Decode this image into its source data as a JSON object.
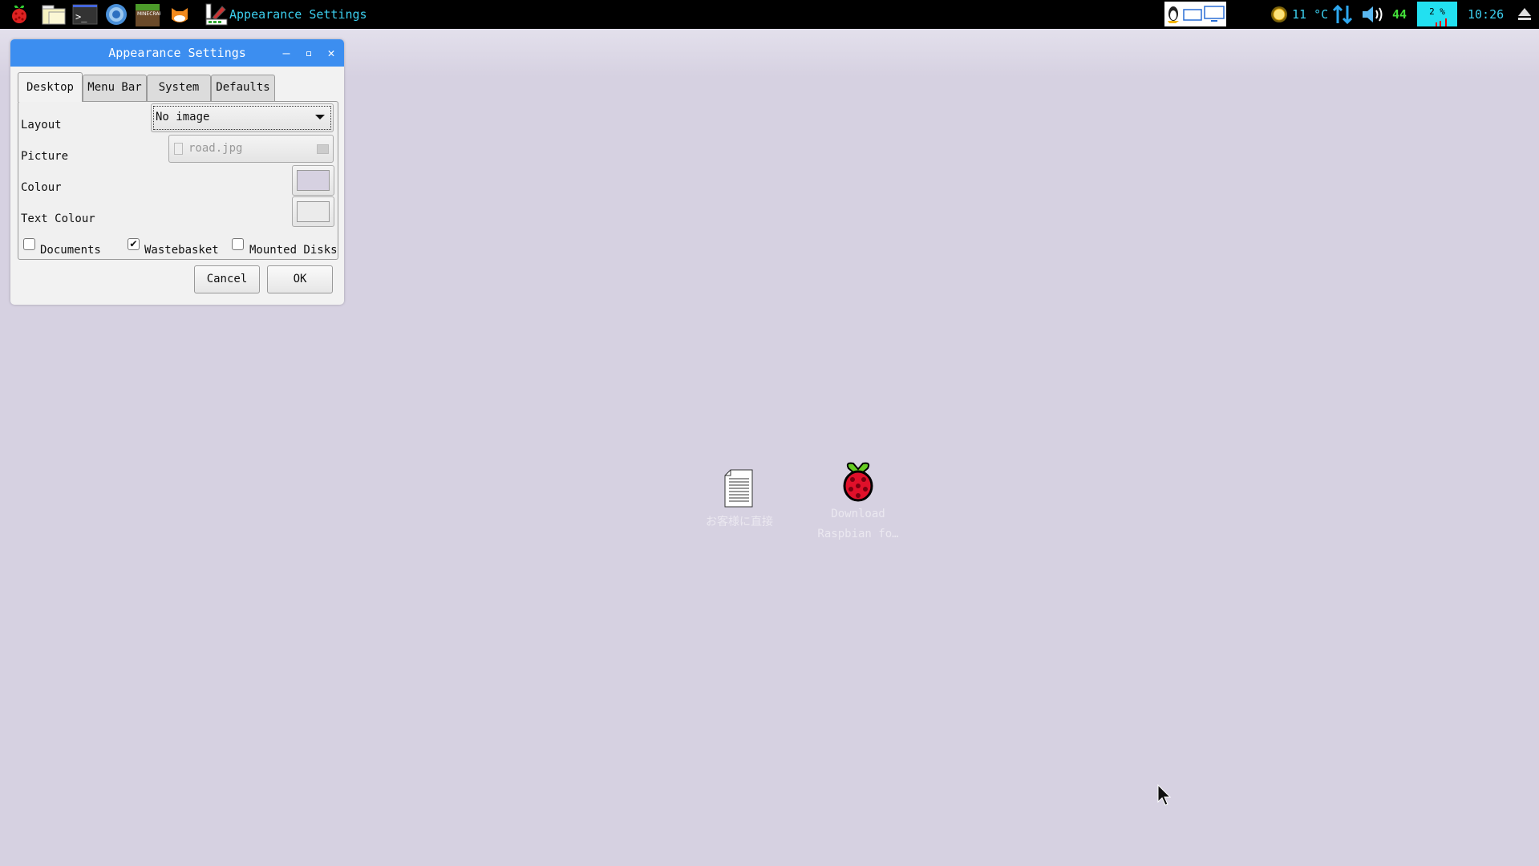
{
  "taskbar": {
    "launchers": [
      "raspberry-menu",
      "file-manager",
      "terminal",
      "chromium",
      "minecraft",
      "scratch"
    ],
    "active_window": "Appearance Settings",
    "tray": {
      "temperature": "11 °C",
      "volume": "44",
      "cpu": "2 %",
      "clock": "10:26"
    }
  },
  "dialog": {
    "title": "Appearance Settings",
    "tabs": [
      {
        "label": "Desktop",
        "active": true
      },
      {
        "label": "Menu Bar"
      },
      {
        "label": "System"
      },
      {
        "label": "Defaults"
      }
    ],
    "layout": {
      "label": "Layout",
      "value": "No image"
    },
    "picture": {
      "label": "Picture",
      "value": "road.jpg"
    },
    "colour": {
      "label": "Colour",
      "value": "#d6d1e1"
    },
    "text_colour": {
      "label": "Text Colour",
      "value": "#ebebeb"
    },
    "checkboxes": [
      {
        "label": "Documents",
        "checked": false
      },
      {
        "label": "Wastebasket",
        "checked": true
      },
      {
        "label": "Mounted Disks",
        "checked": false
      }
    ],
    "cancel": "Cancel",
    "ok": "OK"
  },
  "desktop_icons": [
    {
      "label": "お客様に直接",
      "icon": "text-document-icon"
    },
    {
      "label1": "Download",
      "label2": "Raspbian fo…",
      "icon": "raspberry-icon"
    }
  ],
  "colors": {
    "titlebar": "#3c8ef0",
    "desktop": "#d6d1e1",
    "tray_text": "#3cd0f0"
  }
}
